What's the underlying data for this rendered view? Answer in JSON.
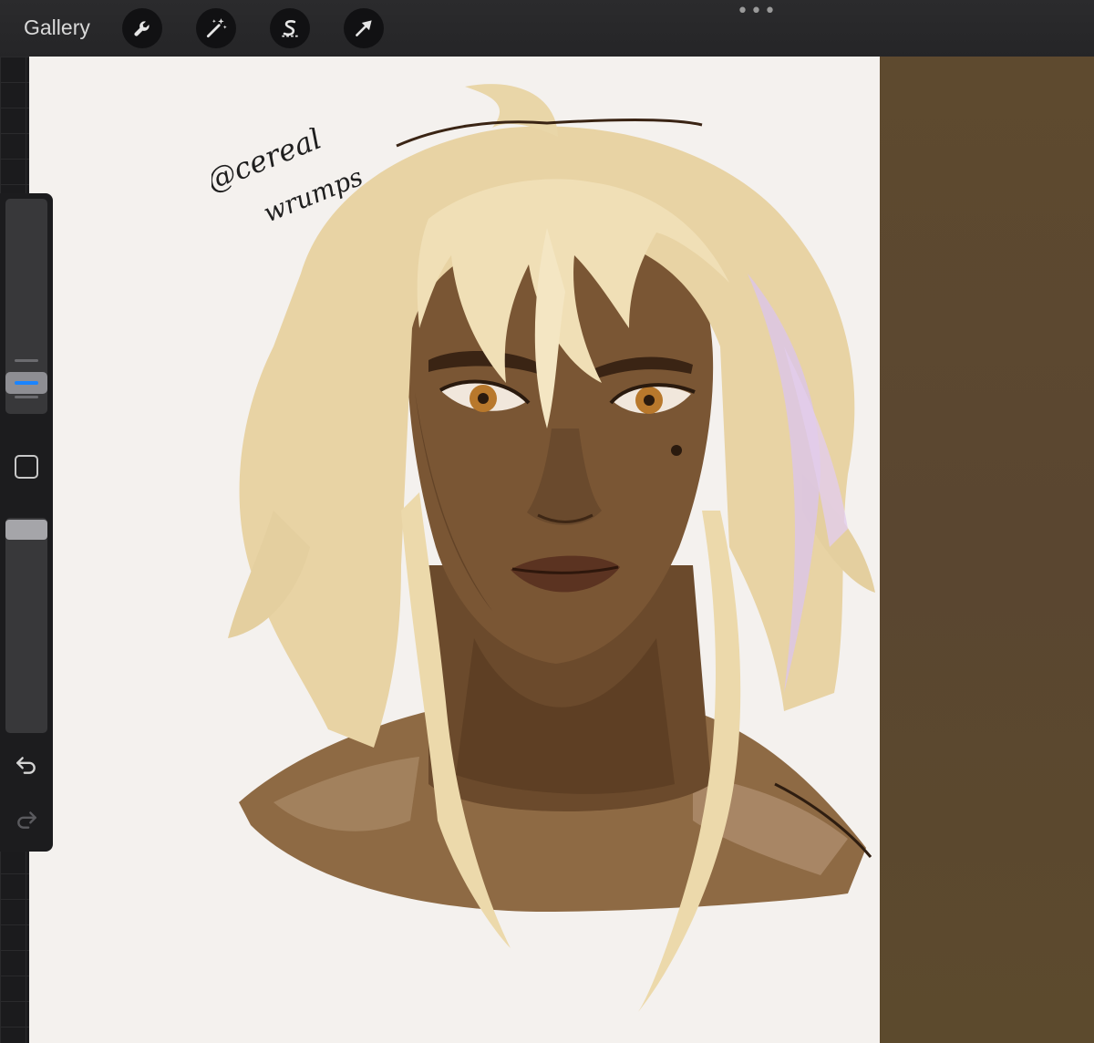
{
  "toolbar": {
    "gallery_label": "Gallery",
    "tools": [
      "wrench-icon",
      "magic-wand-icon",
      "selection-s-icon",
      "transform-arrow-icon"
    ],
    "more_label": "•••"
  },
  "colors": {
    "toolbar_bg": "#2b2b2d",
    "canvas_bg": "#f4f1ee",
    "brush_size_accent": "#1a84ff",
    "right_panel": "#5c4a2d",
    "skin": "#7a5634",
    "hair": "#efdcb0"
  },
  "sidebar": {
    "controls": [
      "brush-size-slider",
      "modify-button",
      "opacity-slider",
      "undo-icon",
      "redo-icon"
    ]
  },
  "canvas": {
    "signature": [
      "@cereal",
      "wrumps"
    ]
  }
}
